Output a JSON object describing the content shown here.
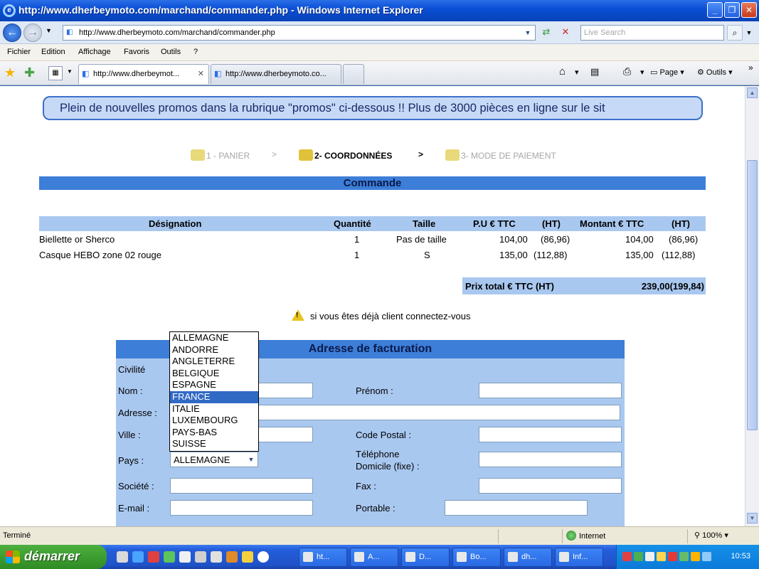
{
  "window": {
    "title": "http://www.dherbeymoto.com/marchand/commander.php - Windows Internet Explorer"
  },
  "addressbar": {
    "url": "http://www.dherbeymoto.com/marchand/commander.php",
    "search_placeholder": "Live Search"
  },
  "menu": [
    "Fichier",
    "Edition",
    "Affichage",
    "Favoris",
    "Outils",
    "?"
  ],
  "tabs": [
    {
      "label": "http://www.dherbeymot..."
    },
    {
      "label": "http://www.dherbeymoto.co..."
    }
  ],
  "commandbar": {
    "page_label": "Page",
    "tools_label": "Outils"
  },
  "page": {
    "promo": "Plein de nouvelles promos dans la rubrique \"promos\" ci-dessous !! Plus de 3000 pièces en ligne sur le sit",
    "steps": [
      {
        "label": "1 - PANIER"
      },
      {
        "label": "2- COORDONNÉES"
      },
      {
        "label": "3- MODE DE PAIEMENT"
      }
    ],
    "step_separator": ">",
    "commande_title": "Commande",
    "order_table": {
      "headers": {
        "designation": "Désignation",
        "quantite": "Quantité",
        "taille": "Taille",
        "pu": "P.U € TTC",
        "pu_ht": "(HT)",
        "montant": "Montant € TTC",
        "montant_ht": "(HT)"
      },
      "rows": [
        {
          "designation": "Biellette or Sherco",
          "quantite": "1",
          "taille": "Pas de taille",
          "pu": "104,00",
          "pu_ht": "(86,96)",
          "montant": "104,00",
          "montant_ht": "(86,96)"
        },
        {
          "designation": "Casque HEBO zone 02 rouge",
          "quantite": "1",
          "taille": "S",
          "pu": "135,00",
          "pu_ht": "(112,88)",
          "montant": "135,00",
          "montant_ht": "(112,88)"
        }
      ]
    },
    "total": {
      "label": "Prix total € TTC (HT)",
      "value": "239,00(199,84)"
    },
    "login_hint": "si vous êtes déjà client connectez-vous",
    "billing": {
      "title": "Adresse de facturation",
      "labels": {
        "civilite": "Civilité",
        "nom": "Nom :",
        "prenom": "Prénom :",
        "adresse": "Adresse :",
        "ville": "Ville :",
        "code_postal": "Code Postal :",
        "pays": "Pays :",
        "telephone_1": "Téléphone",
        "telephone_2": "Domicile (fixe) :",
        "societe": "Société :",
        "fax": "Fax :",
        "email": "E-mail :",
        "portable": "Portable :"
      },
      "pays_selected": "ALLEMAGNE",
      "country_options": [
        "ALLEMAGNE",
        "ANDORRE",
        "ANGLETERRE",
        "BELGIQUE",
        "ESPAGNE",
        "FRANCE",
        "ITALIE",
        "LUXEMBOURG",
        "PAYS-BAS",
        "SUISSE"
      ],
      "highlighted_option": "FRANCE"
    }
  },
  "statusbar": {
    "status": "Terminé",
    "zone": "Internet",
    "zoom": "100%"
  },
  "taskbar": {
    "start_label": "démarrer",
    "tasks": [
      {
        "label": "ht..."
      },
      {
        "label": "A..."
      },
      {
        "label": "D..."
      },
      {
        "label": "Bo..."
      },
      {
        "label": "dh..."
      },
      {
        "label": "Inf..."
      }
    ],
    "clock": "10:53"
  },
  "colors": {
    "header_blue": "#3d7ed8",
    "light_blue": "#a9c8f0",
    "selection": "#316ac5"
  }
}
